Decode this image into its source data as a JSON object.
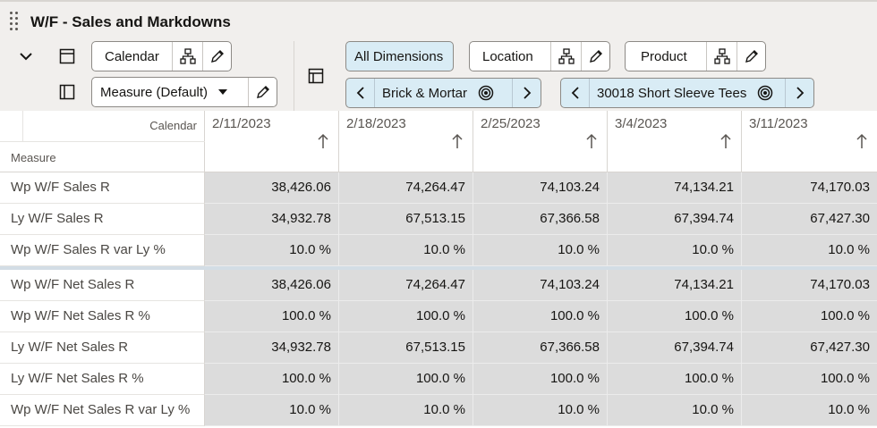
{
  "window": {
    "title": "W/F - Sales and Markdowns"
  },
  "toolbar": {
    "calendar_label": "Calendar",
    "measure_label": "Measure (Default)",
    "all_dimensions_label": "All Dimensions",
    "location_label": "Location",
    "product_label": "Product",
    "location_value": "Brick & Mortar",
    "product_value": "30018 Short Sleeve Tees"
  },
  "grid": {
    "corner_calendar": "Calendar",
    "corner_measure": "Measure",
    "columns": [
      "2/11/2023",
      "2/18/2023",
      "2/25/2023",
      "3/4/2023",
      "3/11/2023"
    ],
    "rows": [
      {
        "label": "Wp W/F Sales R",
        "values": [
          "38,426.06",
          "74,264.47",
          "74,103.24",
          "74,134.21",
          "74,170.03"
        ]
      },
      {
        "label": "Ly W/F Sales R",
        "values": [
          "34,932.78",
          "67,513.15",
          "67,366.58",
          "67,394.74",
          "67,427.30"
        ]
      },
      {
        "label": "Wp W/F Sales R var Ly %",
        "values": [
          "10.0 %",
          "10.0 %",
          "10.0 %",
          "10.0 %",
          "10.0 %"
        ]
      },
      {
        "label": "Wp W/F Net Sales R",
        "values": [
          "38,426.06",
          "74,264.47",
          "74,103.24",
          "74,134.21",
          "74,170.03"
        ]
      },
      {
        "label": "Wp W/F Net Sales R %",
        "values": [
          "100.0 %",
          "100.0 %",
          "100.0 %",
          "100.0 %",
          "100.0 %"
        ]
      },
      {
        "label": "Ly W/F Net Sales R",
        "values": [
          "34,932.78",
          "67,513.15",
          "67,366.58",
          "67,394.74",
          "67,427.30"
        ]
      },
      {
        "label": "Ly W/F Net Sales R %",
        "values": [
          "100.0 %",
          "100.0 %",
          "100.0 %",
          "100.0 %",
          "100.0 %"
        ]
      },
      {
        "label": "Wp W/F Net Sales R var Ly %",
        "values": [
          "10.0 %",
          "10.0 %",
          "10.0 %",
          "10.0 %",
          "10.0 %"
        ]
      }
    ]
  },
  "colors": {
    "selected_pill": "#d9ecf5",
    "cell_bg": "#dcdcdc",
    "toolbar_bg": "#f1efed"
  }
}
